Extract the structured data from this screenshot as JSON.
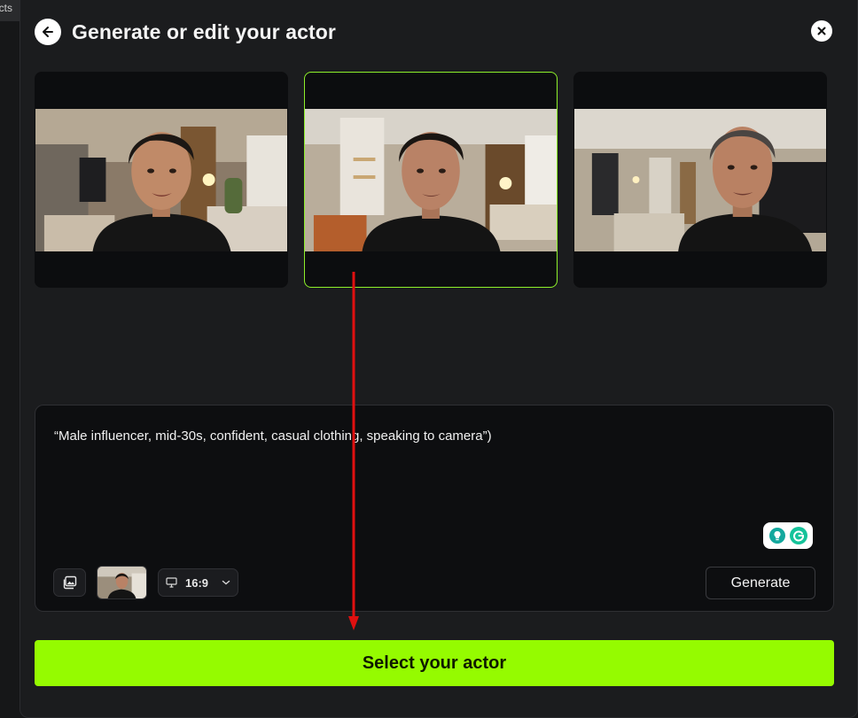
{
  "background": {
    "tab_fragment": "ects"
  },
  "header": {
    "title": "Generate or edit your actor"
  },
  "actors": [
    {
      "id": "actor-1",
      "selected": false
    },
    {
      "id": "actor-2",
      "selected": true
    },
    {
      "id": "actor-3",
      "selected": false
    }
  ],
  "prompt": {
    "text": "“Male influencer, mid-30s, confident, casual clothing, speaking to camera”)"
  },
  "toolbar": {
    "aspect_ratio": "16:9",
    "generate_label": "Generate"
  },
  "footer": {
    "select_label": "Select your actor"
  },
  "colors": {
    "accent": "#95fb00",
    "selected_border": "#8ef02a",
    "annotation_arrow": "#e01010"
  }
}
